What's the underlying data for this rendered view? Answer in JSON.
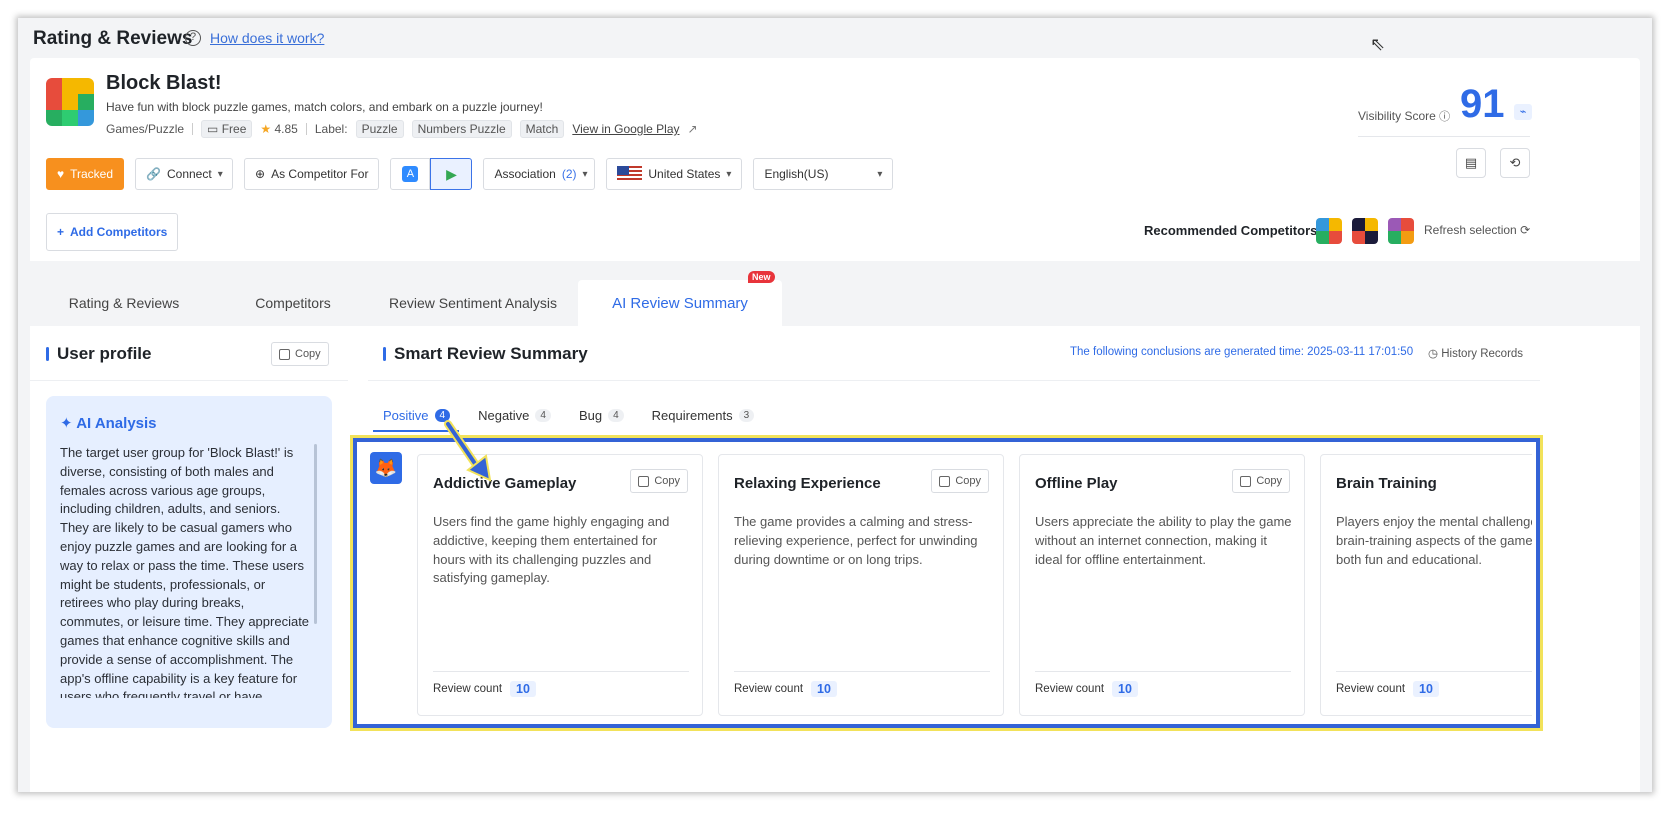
{
  "header": {
    "title": "Rating & Reviews",
    "help_icon": "question-circle-icon",
    "how_link": "How does it work?"
  },
  "app": {
    "name": "Block Blast!",
    "description": "Have fun with block puzzle games, match colors, and embark on a puzzle journey!",
    "category": "Games/Puzzle",
    "price": "Free",
    "rating": "4.85",
    "label_prefix": "Label:",
    "labels": [
      "Puzzle",
      "Numbers Puzzle",
      "Match"
    ],
    "store_link": "View in Google Play"
  },
  "actions": {
    "tracked": "Tracked",
    "connect": "Connect",
    "competitor_for": "As Competitor For",
    "association": "Association",
    "association_count": "(2)",
    "country": "United States",
    "language": "English(US)"
  },
  "visibility": {
    "label": "Visibility Score",
    "score": "91"
  },
  "competitors": {
    "add_label": "Add Competitors",
    "recommended_label": "Recommended Competitors",
    "refresh_label": "Refresh selection"
  },
  "tabs": [
    {
      "label": "Rating & Reviews"
    },
    {
      "label": "Competitors"
    },
    {
      "label": "Review Sentiment Analysis"
    },
    {
      "label": "AI Review Summary",
      "badge": "New"
    }
  ],
  "user_profile": {
    "title": "User profile",
    "copy": "Copy",
    "ai_title": "AI Analysis",
    "ai_text": "The target user group for 'Block Blast!' is diverse, consisting of both males and females across various age groups, including children, adults, and seniors. They are likely to be casual gamers who enjoy puzzle games and are looking for a way to relax or pass the time. These users might be students, professionals, or retirees who play during breaks, commutes, or leisure time. They appreciate games that enhance cognitive skills and provide a sense of accomplishment. The app's offline capability is a key feature for users who frequently travel or have"
  },
  "summary": {
    "title": "Smart Review Summary",
    "generated_text": "The following conclusions are generated time: 2025-03-11 17:01:50",
    "history_label": "History Records",
    "subtabs": [
      {
        "label": "Positive",
        "count": "4"
      },
      {
        "label": "Negative",
        "count": "4"
      },
      {
        "label": "Bug",
        "count": "4"
      },
      {
        "label": "Requirements",
        "count": "3"
      }
    ],
    "cards": [
      {
        "title": "Addictive Gameplay",
        "copy": "Copy",
        "desc": "Users find the game highly engaging and addictive, keeping them entertained for hours with its challenging puzzles and satisfying gameplay.",
        "count_label": "Review count",
        "count": "10"
      },
      {
        "title": "Relaxing Experience",
        "copy": "Copy",
        "desc": "The game provides a calming and stress-relieving experience, perfect for unwinding during downtime or on long trips.",
        "count_label": "Review count",
        "count": "10"
      },
      {
        "title": "Offline Play",
        "copy": "Copy",
        "desc": "Users appreciate the ability to play the game without an internet connection, making it ideal for offline entertainment.",
        "count_label": "Review count",
        "count": "10"
      },
      {
        "title": "Brain Training",
        "copy": "",
        "desc": "Players enjoy the mental challenge and brain-training aspects of the game, finding it both fun and educational.",
        "count_label": "Review count",
        "count": "10"
      }
    ]
  },
  "colors": {
    "accent": "#2f6be6",
    "tracked": "#f7901e",
    "highlight_border": "#3463d6",
    "highlight_outline": "#f2e25a"
  }
}
